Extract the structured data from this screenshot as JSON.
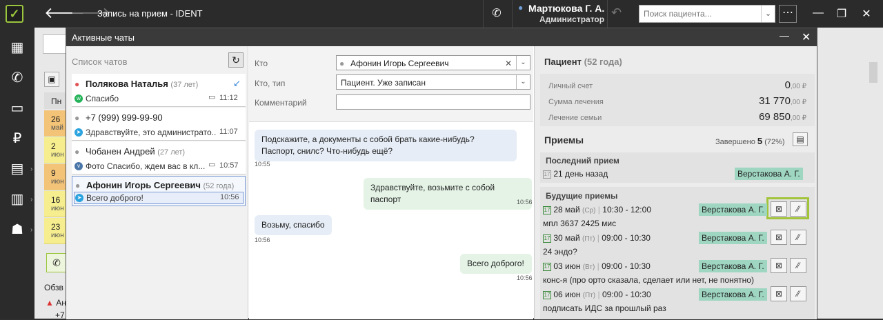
{
  "app": {
    "title": "Запись на прием - IDENT"
  },
  "user": {
    "name": "Мартюкова Г. А.",
    "role": "Администратор"
  },
  "search": {
    "placeholder": "Поиск пациента..."
  },
  "background": {
    "day_header": "Пн",
    "days": [
      {
        "num": "26",
        "month": "май"
      },
      {
        "num": "2",
        "month": "июн"
      },
      {
        "num": "9",
        "month": "июн"
      },
      {
        "num": "16",
        "month": "июн"
      },
      {
        "num": "23",
        "month": "июн"
      }
    ],
    "label": "Обзв",
    "line2": "Ан",
    "line3": "+7"
  },
  "modal": {
    "title": "Активные чаты"
  },
  "chatlist": {
    "title": "Список чатов",
    "items": [
      {
        "name": "Полякова Наталья",
        "age": "(37 лет)",
        "message": "Спасибо",
        "time": "11:12",
        "source": "whatsapp"
      },
      {
        "name": "+7 (999) 999-99-90",
        "age": "",
        "message": "Здравствуйте, это администрато...",
        "time": "11:07",
        "source": "telegram"
      },
      {
        "name": "Чобанен Андрей",
        "age": "(27 лет)",
        "message": "Фото Спасибо, ждем вас в кл...",
        "time": "10:57",
        "source": "vk"
      },
      {
        "name": "Афонин Игорь Сергеевич",
        "age": "(52 года)",
        "message": "Всего доброго!",
        "time": "10:56",
        "source": "telegram"
      }
    ]
  },
  "conversation": {
    "who_label": "Кто",
    "who_value": "Афонин Игорь Сергеевич",
    "type_label": "Кто, тип",
    "type_value": "Пациент. Уже записан",
    "comment_label": "Комментарий",
    "comment_value": "",
    "messages": [
      {
        "dir": "in",
        "text": "Подскажите, а документы с собой брать какие-нибудь? Паспорт, снилс? Что-нибудь ещё?",
        "time": "10:55"
      },
      {
        "dir": "out",
        "text": "Здравствуйте, возьмите с собой паспорт",
        "time": "10:56"
      },
      {
        "dir": "in",
        "text": "Возьму, спасибо",
        "time": "10:56"
      },
      {
        "dir": "out",
        "text": "Всего доброго!",
        "time": "10:56"
      }
    ]
  },
  "patient": {
    "title": "Пациент",
    "age": "(52 года)",
    "finance": [
      {
        "label": "Личный счет",
        "value": "0",
        "fraction": ",00 ₽"
      },
      {
        "label": "Сумма лечения",
        "value": "31 770",
        "fraction": ",00 ₽"
      },
      {
        "label": "Лечение семьи",
        "value": "69 850",
        "fraction": ",00 ₽"
      }
    ],
    "visits_title": "Приемы",
    "done_label": "Завершено",
    "done_count": "5",
    "done_percent": "(72%)",
    "last_title": "Последний прием",
    "last_when": "21 день назад",
    "last_doctor": "Верстакова А. Г.",
    "future_title": "Будущие приемы",
    "future": [
      {
        "date": "28 май",
        "dow": "(Ср)",
        "time": "10:30 - 12:00",
        "doctor": "Верстакова А. Г.",
        "note": "мпл 3637 2425 мис"
      },
      {
        "date": "30 май",
        "dow": "(Пт)",
        "time": "09:00 - 10:30",
        "doctor": "Верстакова А. Г.",
        "note": "24 эндо?"
      },
      {
        "date": "03 июн",
        "dow": "(Вт)",
        "time": "09:00 - 10:30",
        "doctor": "Верстакова А. Г.",
        "note": "конс-я (про орто сказала, сделает или нет, не понятно)"
      },
      {
        "date": "06 июн",
        "dow": "(Пт)",
        "time": "09:00 - 10:30",
        "doctor": "Верстакова А. Г.",
        "note": "подписать ИДС за прошлый раз"
      }
    ]
  }
}
